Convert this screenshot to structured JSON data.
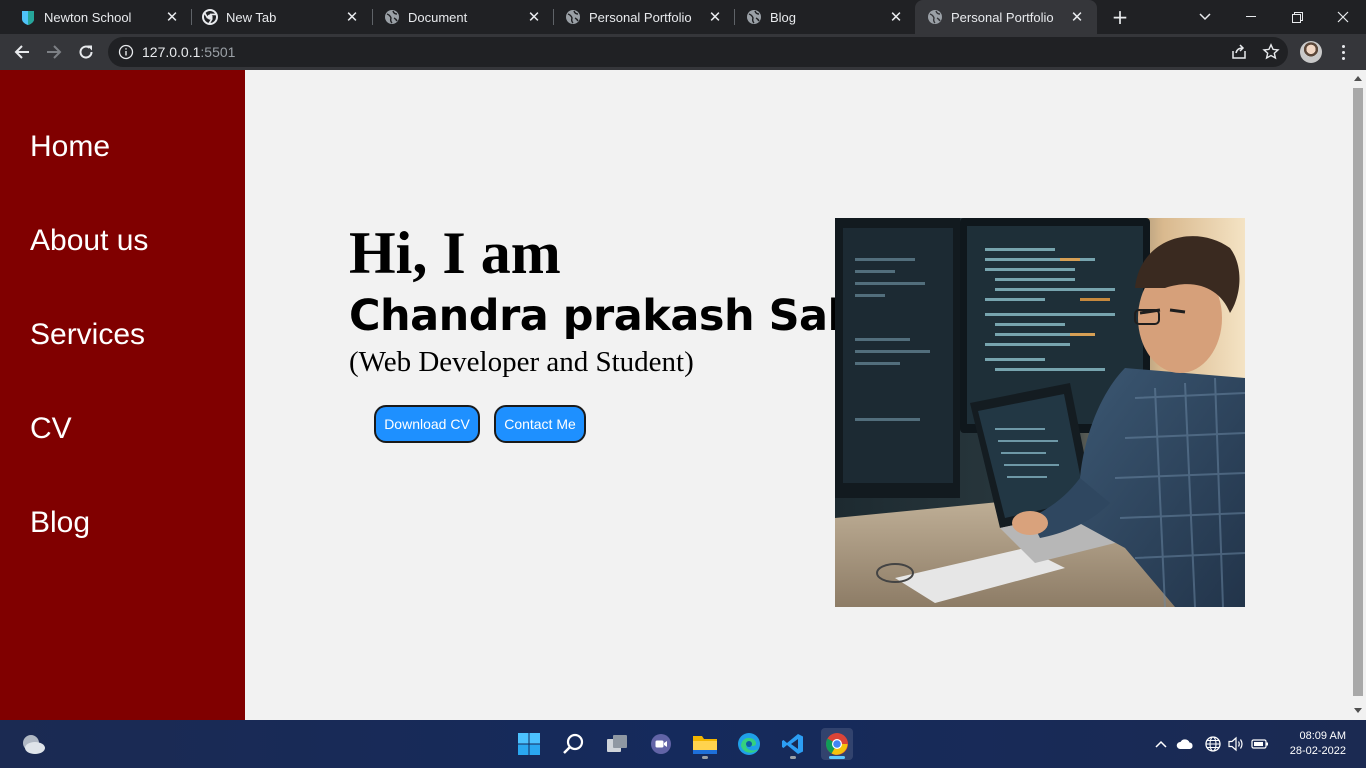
{
  "browser": {
    "tabs": [
      {
        "title": "Newton School",
        "icon": "newton-school-icon"
      },
      {
        "title": "New Tab",
        "icon": "chrome-icon"
      },
      {
        "title": "Document",
        "icon": "globe-icon"
      },
      {
        "title": "Personal Portfolio",
        "icon": "globe-icon"
      },
      {
        "title": "Blog",
        "icon": "globe-icon"
      },
      {
        "title": "Personal Portfolio",
        "icon": "globe-icon",
        "active": true
      }
    ],
    "url_host": "127.0.0.1",
    "url_port": ":5501"
  },
  "sidebar": {
    "items": [
      {
        "label": "Home"
      },
      {
        "label": "About us"
      },
      {
        "label": "Services"
      },
      {
        "label": "CV"
      },
      {
        "label": "Blog"
      }
    ]
  },
  "hero": {
    "greeting": "Hi, I am",
    "name": "Chandra prakash Sah",
    "role": "(Web Developer and Student)",
    "download_label": "Download CV",
    "contact_label": "Contact Me"
  },
  "taskbar": {
    "time": "08:09 AM",
    "date": "28-02-2022"
  },
  "colors": {
    "sidebar_bg": "#800000",
    "button_bg": "#1e90ff",
    "page_bg": "#f2f2f2"
  }
}
